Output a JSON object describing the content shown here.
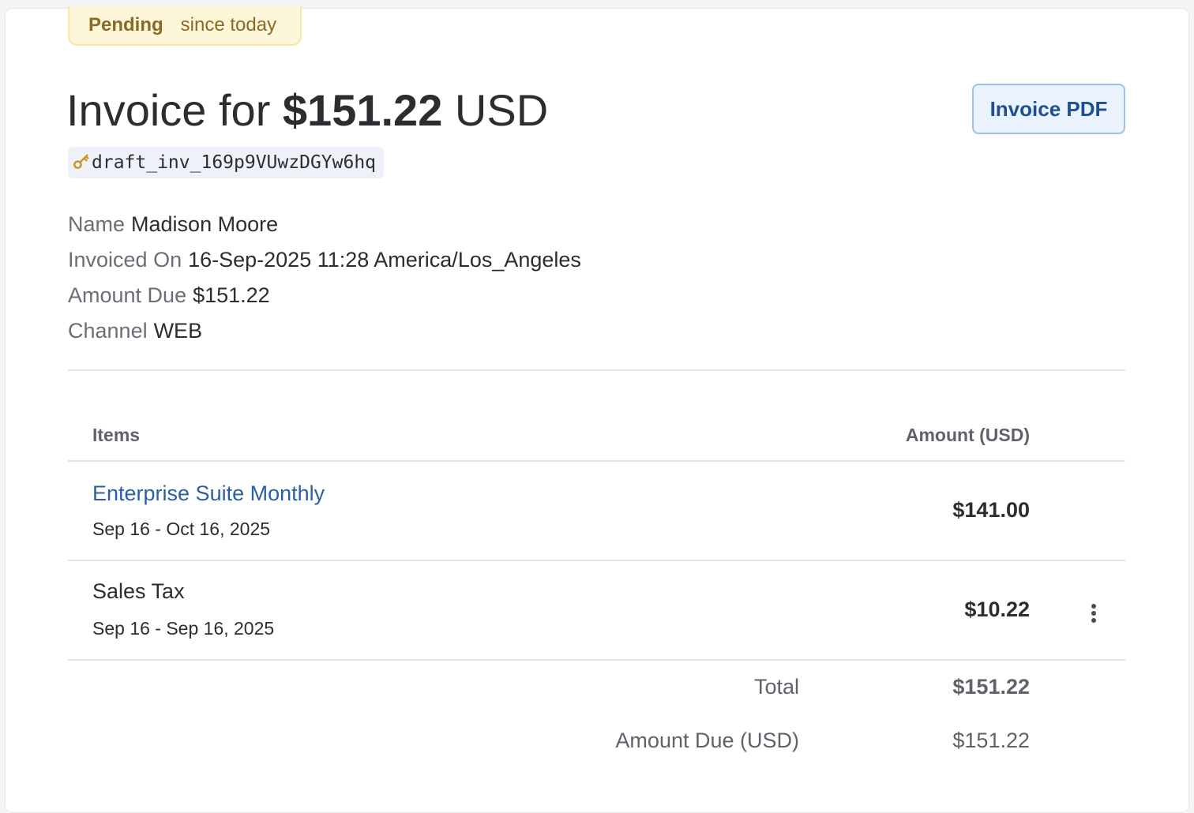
{
  "status": {
    "label": "Pending",
    "since": "since today"
  },
  "header": {
    "title_prefix": "Invoice for",
    "amount": "$151.22",
    "currency": "USD",
    "pdf_button": "Invoice PDF",
    "invoice_id": "draft_inv_169p9VUwzDGYw6hq",
    "id_icon": "key-icon"
  },
  "details": {
    "name_label": "Name",
    "name_value": "Madison Moore",
    "invoiced_label": "Invoiced On",
    "invoiced_value": "16-Sep-2025 11:28 America/Los_Angeles",
    "due_label": "Amount Due",
    "due_value": "$151.22",
    "channel_label": "Channel",
    "channel_value": "WEB"
  },
  "table": {
    "col_items": "Items",
    "col_amount": "Amount (USD)",
    "rows": [
      {
        "title": "Enterprise Suite Monthly",
        "period": "Sep 16 - Oct 16, 2025",
        "amount": "$141.00"
      },
      {
        "title": "Sales Tax",
        "period": "Sep 16 - Sep 16, 2025",
        "amount": "$10.22"
      }
    ]
  },
  "totals": {
    "total_label": "Total",
    "total_value": "$151.22",
    "due_label": "Amount Due (USD)",
    "due_value": "$151.22"
  },
  "colors": {
    "pending_bg": "#fdf6d8",
    "pending_text": "#8a6a26",
    "link": "#2a5fa8",
    "button_bg": "#eaf2fd",
    "button_text": "#1d4f91"
  }
}
